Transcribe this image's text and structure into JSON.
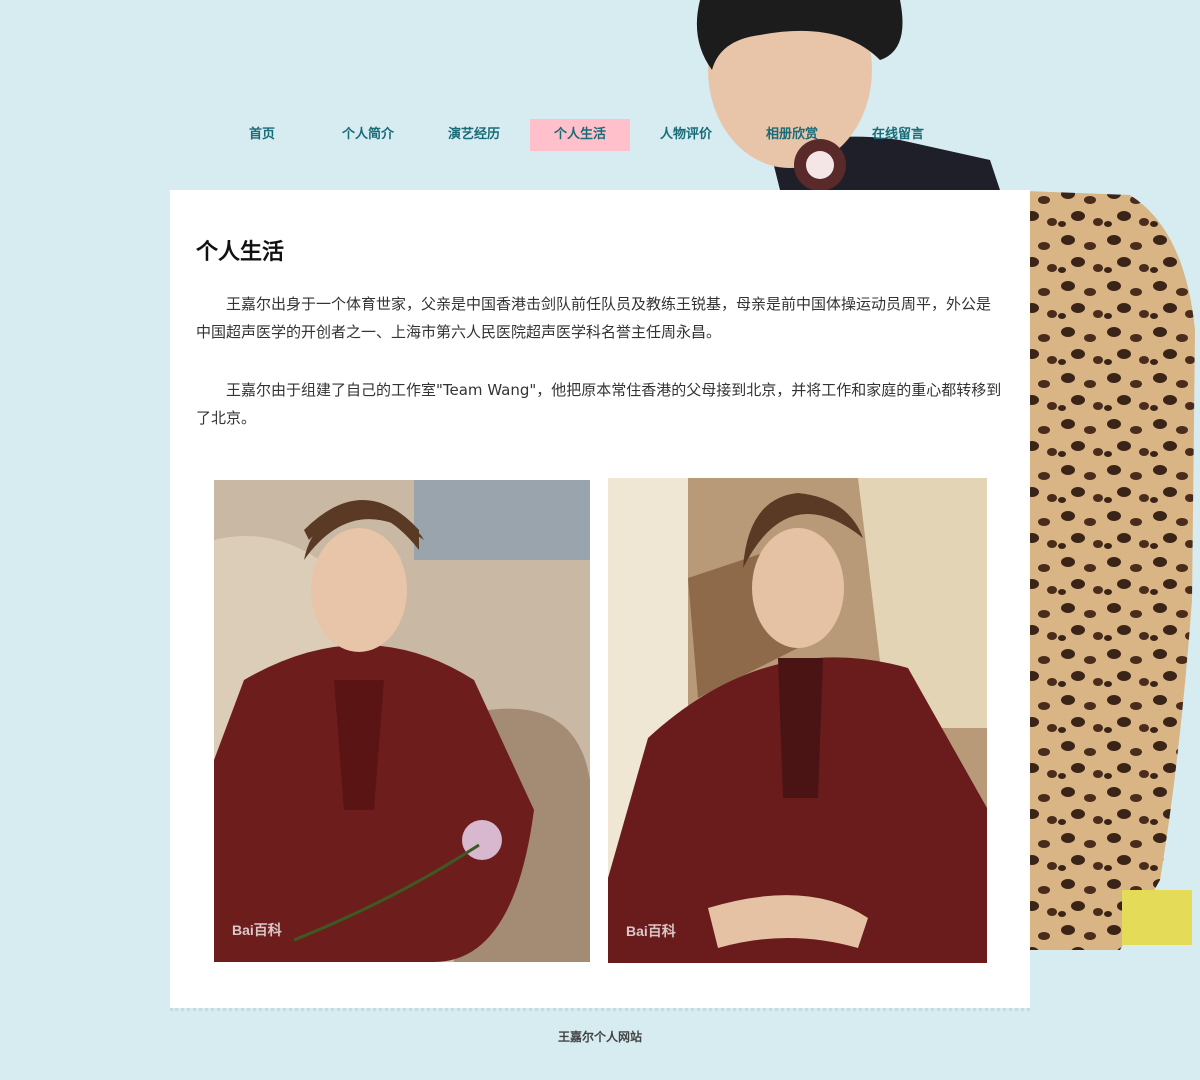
{
  "nav": {
    "items": [
      {
        "label": "首页"
      },
      {
        "label": "个人简介"
      },
      {
        "label": "演艺经历"
      },
      {
        "label": "个人生活",
        "active": true
      },
      {
        "label": "人物评价"
      },
      {
        "label": "相册欣赏"
      },
      {
        "label": "在线留言"
      }
    ]
  },
  "main": {
    "title": "个人生活",
    "paragraphs": [
      "王嘉尔出身于一个体育世家，父亲是中国香港击剑队前任队员及教练王锐基，母亲是前中国体操运动员周平，外公是中国超声医学的开创者之一、上海市第六人民医院超声医学科名誉主任周永昌。",
      "王嘉尔由于组建了自己的工作室\"Team Wang\"，他把原本常住香港的父母接到北京，并将工作和家庭的重心都转移到了北京。"
    ],
    "photos": [
      {
        "watermark": "Bai百科"
      },
      {
        "watermark": "Bai百科"
      }
    ]
  },
  "footer": {
    "text": "王嘉尔个人网站"
  },
  "colors": {
    "background": "#d6ecf1",
    "nav_text": "#1a6b78",
    "nav_active_bg": "#ffc0cb",
    "panel": "#ffffff"
  }
}
